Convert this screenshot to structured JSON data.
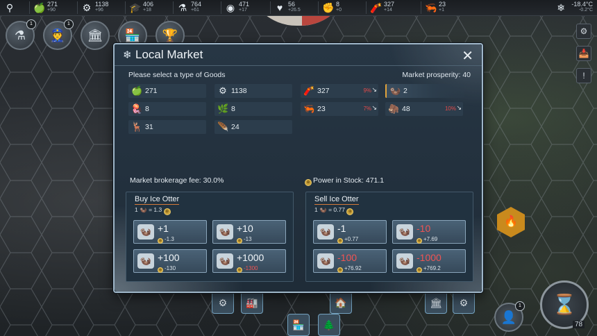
{
  "topbar": {
    "resources": [
      {
        "icon": "magnifier-icon",
        "glyph": "⚲",
        "value": "",
        "delta": ""
      },
      {
        "icon": "apple-icon",
        "glyph": "🍏",
        "value": "271",
        "delta": "+90"
      },
      {
        "icon": "gear-icon",
        "glyph": "⚙",
        "value": "1138",
        "delta": "+96"
      },
      {
        "icon": "mortarboard-icon",
        "glyph": "🎓",
        "value": "406",
        "delta": "+18"
      },
      {
        "icon": "flask-icon",
        "glyph": "⚗",
        "value": "764",
        "delta": "+61"
      },
      {
        "icon": "power-coin-icon",
        "glyph": "◉",
        "value": "471",
        "delta": "+17"
      },
      {
        "icon": "heart-icon",
        "glyph": "♥",
        "value": "56",
        "delta": "+26.5"
      },
      {
        "icon": "fist-icon",
        "glyph": "✊",
        "value": "8",
        "delta": "+0"
      },
      {
        "icon": "dynamite-icon",
        "glyph": "🧨",
        "value": "327",
        "delta": "+14"
      },
      {
        "icon": "shrimp-icon",
        "glyph": "🦐",
        "value": "23",
        "delta": "+1"
      }
    ],
    "temperature": {
      "icon": "snowflake-icon",
      "value": "-18.4°C",
      "delta": "-0.2°C"
    }
  },
  "left_actions": [
    {
      "name": "research-button",
      "glyph": "⚗",
      "badge": "1"
    },
    {
      "name": "officer-button",
      "glyph": "👮",
      "badge": "1"
    },
    {
      "name": "build-button",
      "glyph": "🏛",
      "badge": ""
    },
    {
      "name": "market-button",
      "glyph": "🏪",
      "badge": ""
    },
    {
      "name": "trophy-button",
      "glyph": "🏆",
      "badge": ""
    }
  ],
  "right_actions": [
    {
      "name": "settings-button",
      "glyph": "⚙"
    },
    {
      "name": "inbox-button",
      "glyph": "📥"
    },
    {
      "name": "alert-button",
      "glyph": "!"
    }
  ],
  "bottom": {
    "turn": "78",
    "person_badge": "1"
  },
  "dialog": {
    "title": "Local Market",
    "prompt": "Please select a type of Goods",
    "prosperity": "Market prosperity: 40",
    "goods": [
      {
        "icon": "apple-icon",
        "glyph": "🍏",
        "value": "271",
        "pct": "",
        "arrow": ""
      },
      {
        "icon": "gear-icon",
        "glyph": "⚙",
        "value": "1138",
        "pct": "",
        "arrow": ""
      },
      {
        "icon": "dynamite-icon",
        "glyph": "🧨",
        "value": "327",
        "pct": "9%",
        "arrow": "↘"
      },
      {
        "icon": "ice-otter-icon",
        "glyph": "🦦",
        "value": "2",
        "pct": "",
        "arrow": "",
        "selected": true
      },
      {
        "icon": "jellyfish-icon",
        "glyph": "🪼",
        "value": "8",
        "pct": "",
        "arrow": ""
      },
      {
        "icon": "seaweed-icon",
        "glyph": "🌿",
        "value": "8",
        "pct": "",
        "arrow": ""
      },
      {
        "icon": "shrimp-icon",
        "glyph": "🦐",
        "value": "23",
        "pct": "7%",
        "arrow": "↘"
      },
      {
        "icon": "mammoth-icon",
        "glyph": "🦣",
        "value": "48",
        "pct": "10%",
        "arrow": "↘"
      },
      {
        "icon": "reindeer-icon",
        "glyph": "🦌",
        "value": "31",
        "pct": "",
        "arrow": ""
      },
      {
        "icon": "feather-icon",
        "glyph": "🪶",
        "value": "24",
        "pct": "",
        "arrow": ""
      }
    ],
    "fee": "Market brokerage fee: 30.0%",
    "stock": "Power in Stock:  471.1",
    "buy": {
      "title": "Buy Ice Otter",
      "rate_prefix": "1",
      "rate_value": "= 1.3",
      "buttons": [
        {
          "amount": "+1",
          "cost": "-1.3",
          "red_amount": false,
          "red_cost": false
        },
        {
          "amount": "+10",
          "cost": "-13",
          "red_amount": false,
          "red_cost": false
        },
        {
          "amount": "+100",
          "cost": "-130",
          "red_amount": false,
          "red_cost": false
        },
        {
          "amount": "+1000",
          "cost": "-1300",
          "red_amount": false,
          "red_cost": true
        }
      ]
    },
    "sell": {
      "title": "Sell Ice Otter",
      "rate_prefix": "1",
      "rate_value": "= 0.77",
      "buttons": [
        {
          "amount": "-1",
          "cost": "+0.77",
          "red_amount": false,
          "red_cost": false
        },
        {
          "amount": "-10",
          "cost": "+7.69",
          "red_amount": true,
          "red_cost": false
        },
        {
          "amount": "-100",
          "cost": "+76.92",
          "red_amount": true,
          "red_cost": false
        },
        {
          "amount": "-1000",
          "cost": "+769.2",
          "red_amount": true,
          "red_cost": false
        }
      ]
    }
  }
}
